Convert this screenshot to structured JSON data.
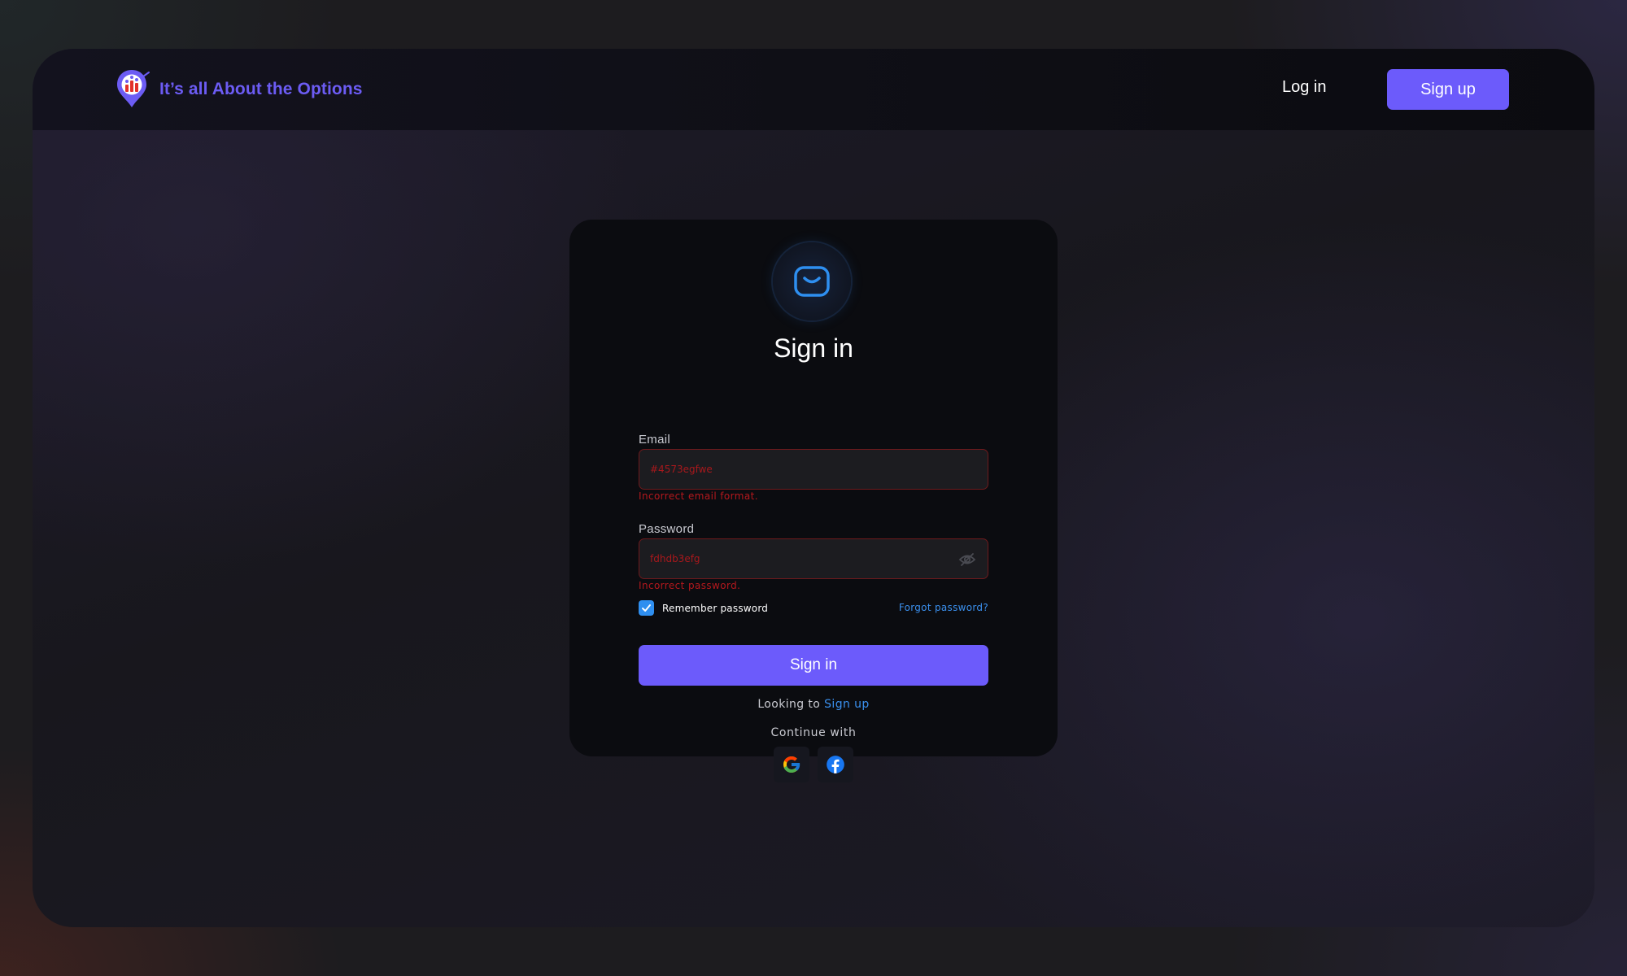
{
  "header": {
    "brand_name": "It’s all About the Options",
    "login_label": "Log in",
    "signup_label": "Sign up",
    "brand_color": "#6c5cf4"
  },
  "signin_card": {
    "icon": "mail-icon",
    "title": "Sign in",
    "email": {
      "label": "Email",
      "value": "#4573egfwe",
      "error": "Incorrect email format."
    },
    "password": {
      "label": "Password",
      "value": "fdhdb3efg",
      "error": "Incorrect password.",
      "visibility_icon": "eye-off-icon"
    },
    "remember": {
      "label": "Remember password",
      "checked": true
    },
    "forgot_label": "Forgot password?",
    "submit_label": "Sign in",
    "signup_prompt": "Looking to ",
    "signup_link": "Sign up",
    "continue_label": "Continue with",
    "social": [
      "google-icon",
      "facebook-icon"
    ]
  },
  "colors": {
    "accent": "#6c5bfb",
    "link": "#3b90ee",
    "error": "#b4181d",
    "card_bg": "#0b0c10"
  }
}
